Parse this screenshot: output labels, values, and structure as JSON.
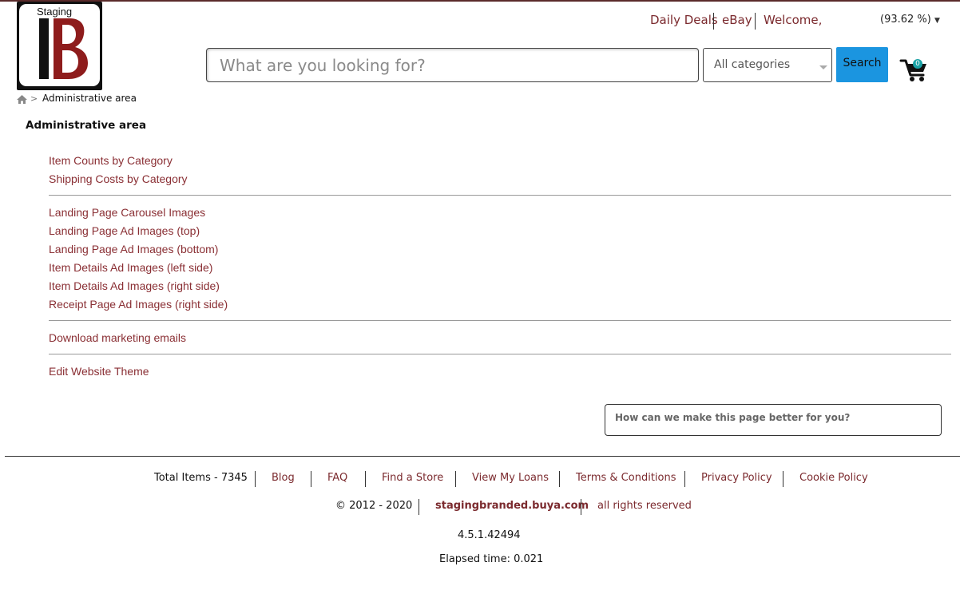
{
  "logo": {
    "text": "Staging"
  },
  "header": {
    "links": [
      "Daily Deals",
      "eBay",
      "Welcome,"
    ],
    "percent": "(93.62 %)"
  },
  "search": {
    "placeholder": "What are you looking for?",
    "category": "All categories",
    "button": "Search",
    "cart_count": "0"
  },
  "breadcrumb": {
    "current": "Administrative area"
  },
  "page": {
    "title": "Administrative area"
  },
  "admin_groups": [
    [
      "Item Counts by Category",
      "Shipping Costs by Category"
    ],
    [
      "Landing Page Carousel Images",
      "Landing Page Ad Images (top)",
      "Landing Page Ad Images (bottom)",
      "Item Details Ad Images (left side)",
      "Item Details Ad Images (right side)",
      "Receipt Page Ad Images (right side)"
    ],
    [
      "Download marketing emails"
    ],
    [
      "Edit Website Theme"
    ]
  ],
  "feedback": {
    "label": "How can we make this page better for you?"
  },
  "footer": {
    "total_items": "Total Items - 7345",
    "links": [
      "Blog",
      "FAQ",
      "Find a Store",
      "View My Loans",
      "Terms & Conditions",
      "Privacy Policy",
      "Cookie Policy"
    ],
    "copyright": "© 2012 - 2020",
    "domain": "stagingbranded.buya.com",
    "rights": "all rights reserved",
    "version": "4.5.1.42494",
    "elapsed": "Elapsed time: 0.021"
  },
  "colors": {
    "link": "#8a2f34",
    "search_button": "#1b95e0",
    "cart_badge": "#1aa2a6"
  }
}
